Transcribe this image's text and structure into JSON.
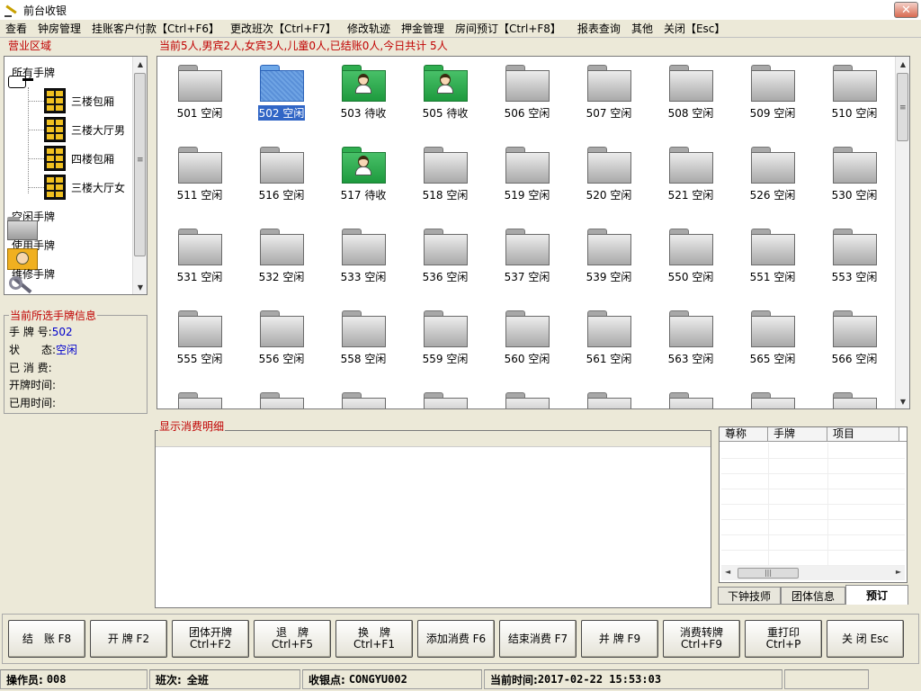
{
  "window": {
    "title": "前台收银"
  },
  "menu": [
    "查看",
    "钟房管理",
    "挂账客户付款【Ctrl+F6】",
    "更改班次【Ctrl+F7】",
    "修改轨迹",
    "押金管理",
    "房间预订【Ctrl+F8】",
    "报表查询",
    "其他",
    "关闭【Esc】"
  ],
  "area": {
    "label": "营业区域",
    "items": [
      {
        "label": "所有手牌",
        "icon": "hand-pointer-icon"
      },
      {
        "label": "三楼包厢",
        "icon": "cabinet-icon"
      },
      {
        "label": "三楼大厅男",
        "icon": "cabinet-icon"
      },
      {
        "label": "四楼包厢",
        "icon": "cabinet-icon"
      },
      {
        "label": "三楼大厅女",
        "icon": "cabinet-icon"
      },
      {
        "label": "空闲手牌",
        "icon": "gray-folder-icon"
      },
      {
        "label": "使用手牌",
        "icon": "person-folder-icon"
      },
      {
        "label": "维修手牌",
        "icon": "wrench-icon"
      }
    ]
  },
  "summary": "当前5人,男宾2人,女宾3人,儿童0人,已结账0人,今日共计 5人",
  "tags": [
    {
      "id": "501",
      "status": "空闲",
      "state": "free"
    },
    {
      "id": "502",
      "status": "空闲",
      "state": "selected"
    },
    {
      "id": "503",
      "status": "待收",
      "state": "occupied"
    },
    {
      "id": "505",
      "status": "待收",
      "state": "occupied"
    },
    {
      "id": "506",
      "status": "空闲",
      "state": "free"
    },
    {
      "id": "507",
      "status": "空闲",
      "state": "free"
    },
    {
      "id": "508",
      "status": "空闲",
      "state": "free"
    },
    {
      "id": "509",
      "status": "空闲",
      "state": "free"
    },
    {
      "id": "510",
      "status": "空闲",
      "state": "free"
    },
    {
      "id": "511",
      "status": "空闲",
      "state": "free"
    },
    {
      "id": "516",
      "status": "空闲",
      "state": "free"
    },
    {
      "id": "517",
      "status": "待收",
      "state": "occupied"
    },
    {
      "id": "518",
      "status": "空闲",
      "state": "free"
    },
    {
      "id": "519",
      "status": "空闲",
      "state": "free"
    },
    {
      "id": "520",
      "status": "空闲",
      "state": "free"
    },
    {
      "id": "521",
      "status": "空闲",
      "state": "free"
    },
    {
      "id": "526",
      "status": "空闲",
      "state": "free"
    },
    {
      "id": "530",
      "status": "空闲",
      "state": "free"
    },
    {
      "id": "531",
      "status": "空闲",
      "state": "free"
    },
    {
      "id": "532",
      "status": "空闲",
      "state": "free"
    },
    {
      "id": "533",
      "status": "空闲",
      "state": "free"
    },
    {
      "id": "536",
      "status": "空闲",
      "state": "free"
    },
    {
      "id": "537",
      "status": "空闲",
      "state": "free"
    },
    {
      "id": "539",
      "status": "空闲",
      "state": "free"
    },
    {
      "id": "550",
      "status": "空闲",
      "state": "free"
    },
    {
      "id": "551",
      "status": "空闲",
      "state": "free"
    },
    {
      "id": "553",
      "status": "空闲",
      "state": "free"
    },
    {
      "id": "555",
      "status": "空闲",
      "state": "free"
    },
    {
      "id": "556",
      "status": "空闲",
      "state": "free"
    },
    {
      "id": "558",
      "status": "空闲",
      "state": "free"
    },
    {
      "id": "559",
      "status": "空闲",
      "state": "free"
    },
    {
      "id": "560",
      "status": "空闲",
      "state": "free"
    },
    {
      "id": "561",
      "status": "空闲",
      "state": "free"
    },
    {
      "id": "563",
      "status": "空闲",
      "state": "free"
    },
    {
      "id": "565",
      "status": "空闲",
      "state": "free"
    },
    {
      "id": "566",
      "status": "空闲",
      "state": "free"
    }
  ],
  "info": {
    "label": "当前所选手牌信息",
    "tag_no_label": "手 牌 号:",
    "tag_no": "502",
    "state_label": "状　　态:",
    "state": "空闲",
    "consumed_label": "已 消 费:",
    "open_time_label": "开牌时间:",
    "used_time_label": "已用时间:"
  },
  "detail": {
    "label": "显示消费明细"
  },
  "right_table": {
    "columns": [
      "尊称",
      "手牌",
      "项目"
    ]
  },
  "right_tabs": [
    "下钟技师",
    "团体信息",
    "预订"
  ],
  "buttons": [
    {
      "name": "settle-button",
      "line1": "结　账 F8",
      "line2": ""
    },
    {
      "name": "open-tag-button",
      "line1": "开 牌 F2",
      "line2": ""
    },
    {
      "name": "group-open-button",
      "line1": "团体开牌",
      "line2": "Ctrl+F2"
    },
    {
      "name": "return-tag-button",
      "line1": "退　牌",
      "line2": "Ctrl+F5"
    },
    {
      "name": "change-tag-button",
      "line1": "换　牌",
      "line2": "Ctrl+F1"
    },
    {
      "name": "add-consumption-button",
      "line1": "添加消费 F6",
      "line2": ""
    },
    {
      "name": "end-consumption-button",
      "line1": "结束消费 F7",
      "line2": ""
    },
    {
      "name": "merge-tag-button",
      "line1": "并 牌 F9",
      "line2": ""
    },
    {
      "name": "transfer-consumption-button",
      "line1": "消费转牌",
      "line2": "Ctrl+F9"
    },
    {
      "name": "reprint-button",
      "line1": "重打印",
      "line2": "Ctrl+P"
    },
    {
      "name": "close-button",
      "line1": "关 闭 Esc",
      "line2": ""
    }
  ],
  "status": {
    "operator_label": "操作员:",
    "operator": "008",
    "shift_label": "班次:",
    "shift": "全班",
    "pos_label": "收银点:",
    "pos": "CONGYU002",
    "time_label": "当前时间:",
    "time": "2017-02-22 15:53:03"
  }
}
